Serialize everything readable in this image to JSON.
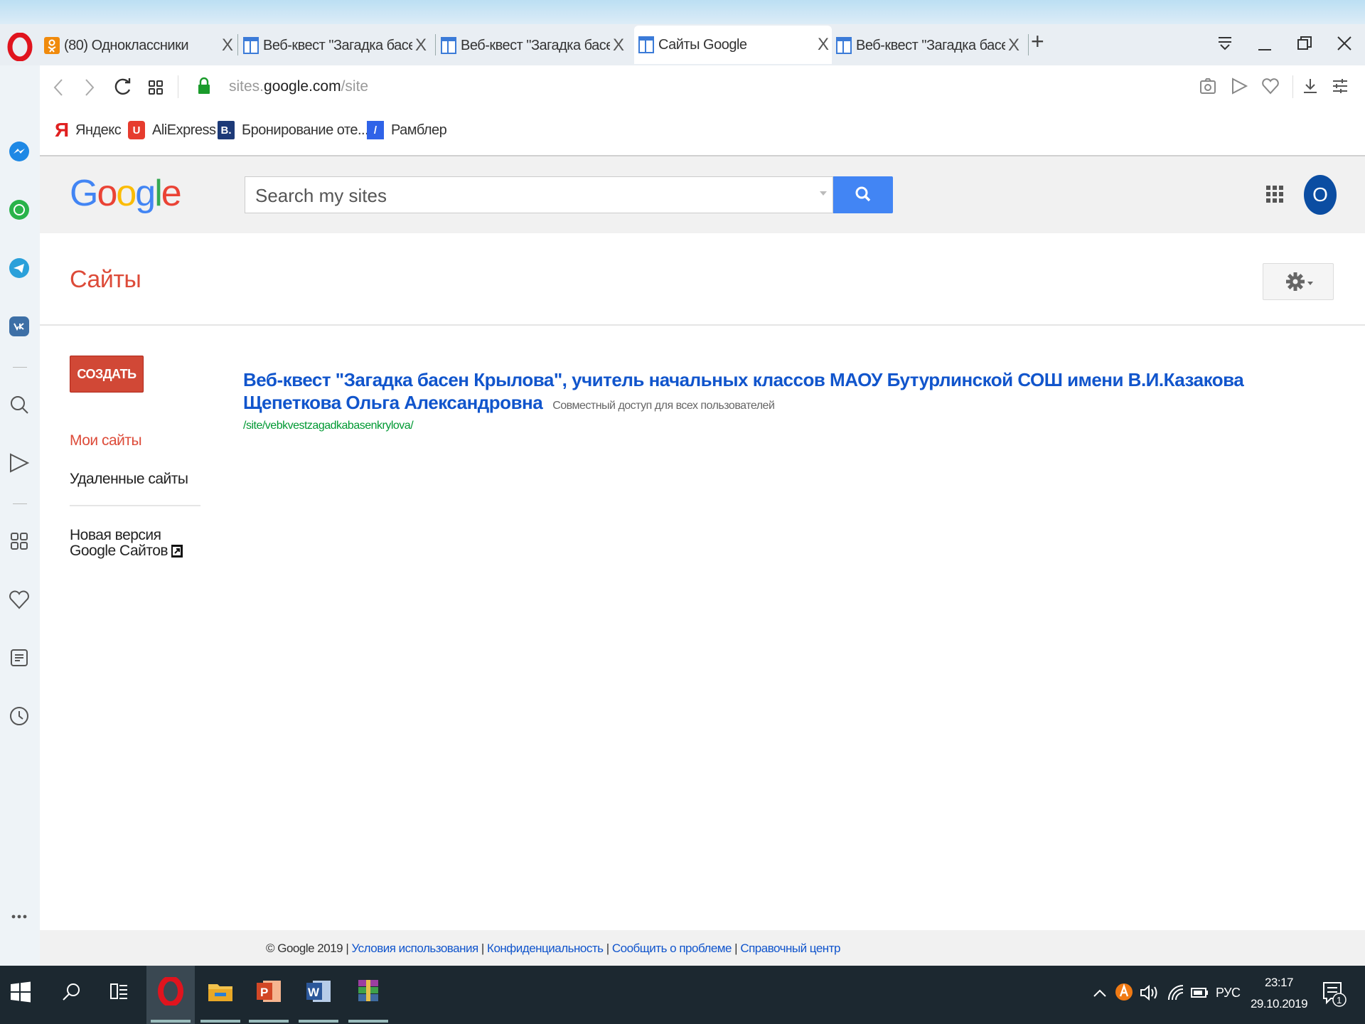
{
  "browser": {
    "tabs": [
      {
        "label": "(80) Одноклассники",
        "icon": "odnoklassniki-icon",
        "active": false
      },
      {
        "label": "Веб-квест \"Загадка басен",
        "icon": "sites-page-icon",
        "active": false
      },
      {
        "label": "Веб-квест \"Загадка басен",
        "icon": "sites-page-icon",
        "active": false
      },
      {
        "label": "Сайты Google",
        "icon": "sites-page-icon",
        "active": true
      },
      {
        "label": "Веб-квест \"Загадка басен",
        "icon": "sites-page-icon",
        "active": false
      }
    ],
    "close_glyph": "X",
    "new_tab_glyph": "+",
    "url_prefix": "sites.",
    "url_domain": "google.com",
    "url_path": "/site",
    "bookmarks": [
      {
        "label": "Яндекс",
        "icon": "yandex-icon",
        "glyph": "Я",
        "color": "#e02020"
      },
      {
        "label": "AliExpress",
        "icon": "aliexpress-icon",
        "glyph": "U",
        "color": "#e63c2e"
      },
      {
        "label": "Бронирование оте...",
        "icon": "booking-icon",
        "glyph": "B.",
        "color": "#1d3a78"
      },
      {
        "label": "Рамблер",
        "icon": "rambler-icon",
        "glyph": "/",
        "color": "#2f63e8"
      }
    ]
  },
  "google": {
    "logo": "Google",
    "search_placeholder": "Search my sites",
    "avatar_letter": "O"
  },
  "page": {
    "title": "Сайты",
    "create_label": "СОЗДАТЬ",
    "nav": {
      "my_sites": "Мои сайты",
      "deleted_sites": "Удаленные сайты",
      "new_version": "Новая версия Google Сайтов"
    },
    "site": {
      "title": "Веб-квест \"Загадка басен Крылова\", учитель начальных классов МАОУ Бутурлинской СОШ имени В.И.Казакова Щепеткова Ольга Александровна",
      "sharing": "Совместный доступ для всех пользователей",
      "url": "/site/vebkvestzagadkabasenkrylova/"
    }
  },
  "footer": {
    "copyright": "© Google 2019",
    "links": [
      "Условия использования",
      "Конфиденциальность",
      "Сообщить о проблеме",
      "Справочный центр"
    ]
  },
  "taskbar": {
    "language": "РУС",
    "time": "23:17",
    "date": "29.10.2019",
    "notification_count": "1"
  },
  "colors": {
    "accent_red": "#dd4b39",
    "create_red": "#d14836",
    "search_blue": "#4285f4",
    "link_blue": "#1155cc",
    "url_green": "#009933"
  }
}
